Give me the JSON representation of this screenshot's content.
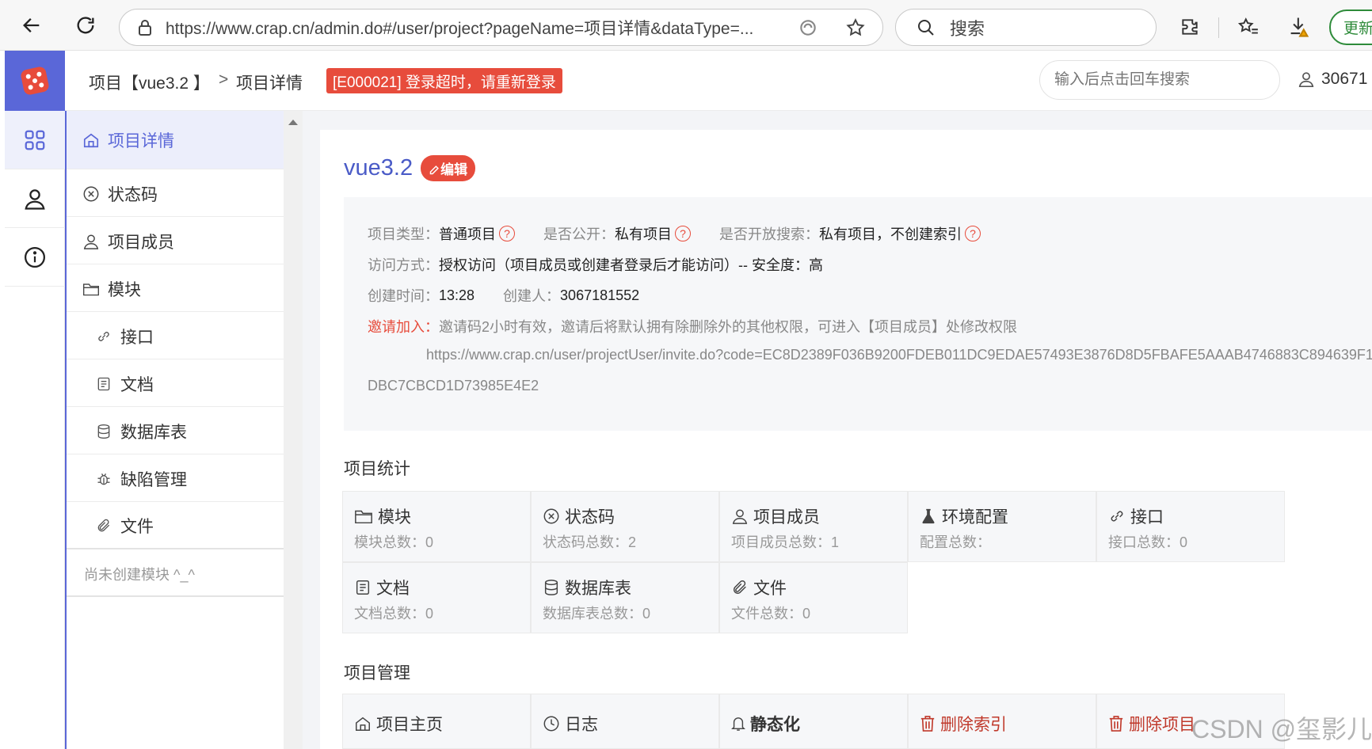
{
  "browser": {
    "url": "https://www.crap.cn/admin.do#/user/project?pageName=项目详情&dataType=...",
    "search_placeholder": "搜索",
    "update_label": "更新"
  },
  "header": {
    "crumb_project": "项目【vue3.2 】",
    "crumb_sep": ">",
    "crumb_page": "项目详情",
    "error_message": "[E000021] 登录超时，请重新登录",
    "search_placeholder": "输入后点击回车搜索",
    "user_name": "30671"
  },
  "rail": {
    "items": [
      "grid-icon",
      "user-icon",
      "info-icon"
    ]
  },
  "sidebar": {
    "items": [
      {
        "label": "项目详情",
        "icon": "home-icon",
        "active": true
      },
      {
        "label": "状态码",
        "icon": "x-circle-icon"
      },
      {
        "label": "项目成员",
        "icon": "user-icon"
      },
      {
        "label": "模块",
        "icon": "folder-icon"
      },
      {
        "label": "接口",
        "icon": "link-icon"
      },
      {
        "label": "文档",
        "icon": "document-icon"
      },
      {
        "label": "数据库表",
        "icon": "database-icon"
      },
      {
        "label": "缺陷管理",
        "icon": "bug-icon"
      },
      {
        "label": "文件",
        "icon": "paperclip-icon"
      }
    ],
    "empty_note": "尚未创建模块 ^_^"
  },
  "project": {
    "title": "vue3.2",
    "edit_label": "编辑",
    "type_label": "项目类型：",
    "type_value": "普通项目",
    "public_label": "是否公开：",
    "public_value": "私有项目",
    "search_label": "是否开放搜索：",
    "search_value": "私有项目，不创建索引",
    "access_label": "访问方式：",
    "access_value": "授权访问（项目成员或创建者登录后才能访问）-- 安全度：高",
    "created_label": "创建时间：",
    "created_value": "13:28",
    "creator_label": "创建人：",
    "creator_value": "3067181552",
    "invite_label": "邀请加入：",
    "invite_text": "邀请码2小时有效，邀请后将默认拥有除删除外的其他权限，可进入【项目成员】处修改权限",
    "invite_url": "https://www.crap.cn/user/projectUser/invite.do?code=EC8D2389F036B9200FDEB011DC9EDAE57493E3876D8D5FBAFE5AAAB4746883C894639F1",
    "invite_url_cont": "DBC7CBCD1D73985E4E2"
  },
  "stats": {
    "title": "项目统计",
    "items": [
      {
        "label": "模块",
        "sub": "模块总数：0",
        "icon": "folder-icon"
      },
      {
        "label": "状态码",
        "sub": "状态码总数：2",
        "icon": "x-circle-icon"
      },
      {
        "label": "项目成员",
        "sub": "项目成员总数：1",
        "icon": "user-icon"
      },
      {
        "label": "环境配置",
        "sub": "配置总数：",
        "icon": "flask-icon"
      },
      {
        "label": "接口",
        "sub": "接口总数：0",
        "icon": "link-icon"
      },
      {
        "label": "文档",
        "sub": "文档总数：0",
        "icon": "document-icon"
      },
      {
        "label": "数据库表",
        "sub": "数据库表总数：0",
        "icon": "database-icon"
      },
      {
        "label": "文件",
        "sub": "文件总数：0",
        "icon": "paperclip-icon"
      }
    ]
  },
  "manage": {
    "title": "项目管理",
    "items": [
      {
        "label": "项目主页",
        "icon": "home-icon"
      },
      {
        "label": "日志",
        "icon": "clock-icon"
      },
      {
        "label": "静态化",
        "icon": "bell-icon"
      },
      {
        "label": "删除索引",
        "icon": "trash-icon"
      },
      {
        "label": "删除项目",
        "icon": "trash-icon"
      }
    ]
  },
  "watermark": "CSDN @玺影儿",
  "colors": {
    "accent": "#5a67d8",
    "danger": "#e74c3c",
    "update": "#2e8b3a"
  }
}
